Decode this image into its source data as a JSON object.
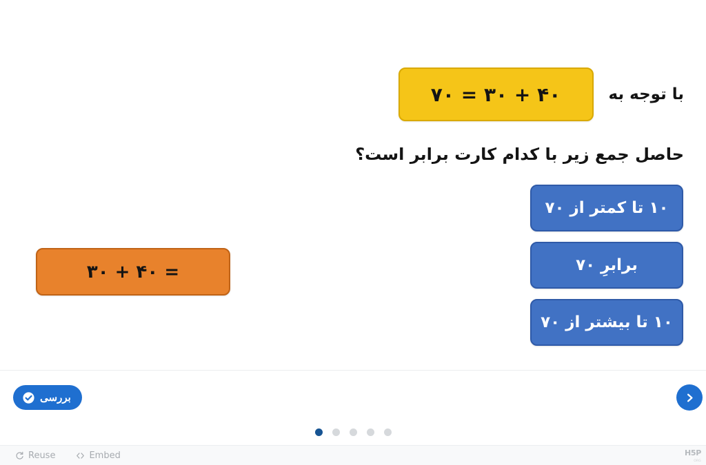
{
  "slide": {
    "intro_text": "با توجه به",
    "reference_card": {
      "text": "۴۰ + ۳۰ = ۷۰",
      "bg_color": "#f5c518",
      "border_color": "#d9a900"
    },
    "question": "حاصل جمع زیر با کدام کارت برابر است؟",
    "options": [
      {
        "label": "۱۰ تا کمتر از ۷۰"
      },
      {
        "label": "برابرِ ۷۰"
      },
      {
        "label": "۱۰ تا بیشتر از ۷۰"
      }
    ],
    "option_colors": {
      "bg": "#4172c4",
      "border": "#2f5aa8",
      "text": "#ffffff"
    },
    "sum_card": {
      "text": "= ۴۰ + ۳۰",
      "bg_color": "#e8822c",
      "border_color": "#c06316"
    }
  },
  "action_bar": {
    "check_label": "بررسی",
    "check_icon": "check-circle-icon",
    "next_icon": "chevron-right-icon",
    "accent_color": "#1f6fd0",
    "dots": {
      "count": 5,
      "active_index": 0,
      "active_color": "#175493",
      "inactive_color": "#d6d9dc"
    }
  },
  "footer": {
    "reuse_label": "Reuse",
    "reuse_icon": "reuse-refresh-icon",
    "embed_label": "Embed",
    "embed_icon": "code-brackets-icon",
    "logo_text": "H5P",
    "logo_sub": "ORG"
  }
}
